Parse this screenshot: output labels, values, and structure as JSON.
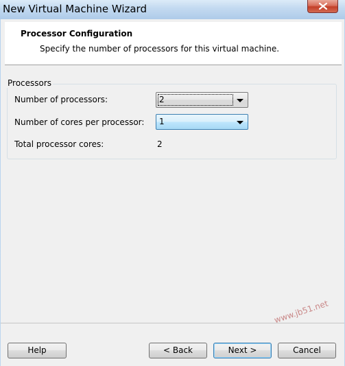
{
  "window": {
    "title": "New Virtual Machine Wizard"
  },
  "header": {
    "title": "Processor Configuration",
    "subtitle": "Specify the number of processors for this virtual machine."
  },
  "processors": {
    "group_label": "Processors",
    "num_processors_label": "Number of processors:",
    "num_processors_value": "2",
    "cores_label": "Number of cores per processor:",
    "cores_value": "1",
    "total_label": "Total processor cores:",
    "total_value": "2"
  },
  "buttons": {
    "help": "Help",
    "back": "< Back",
    "next": "Next >",
    "cancel": "Cancel"
  },
  "watermark": "www.jb51.net"
}
